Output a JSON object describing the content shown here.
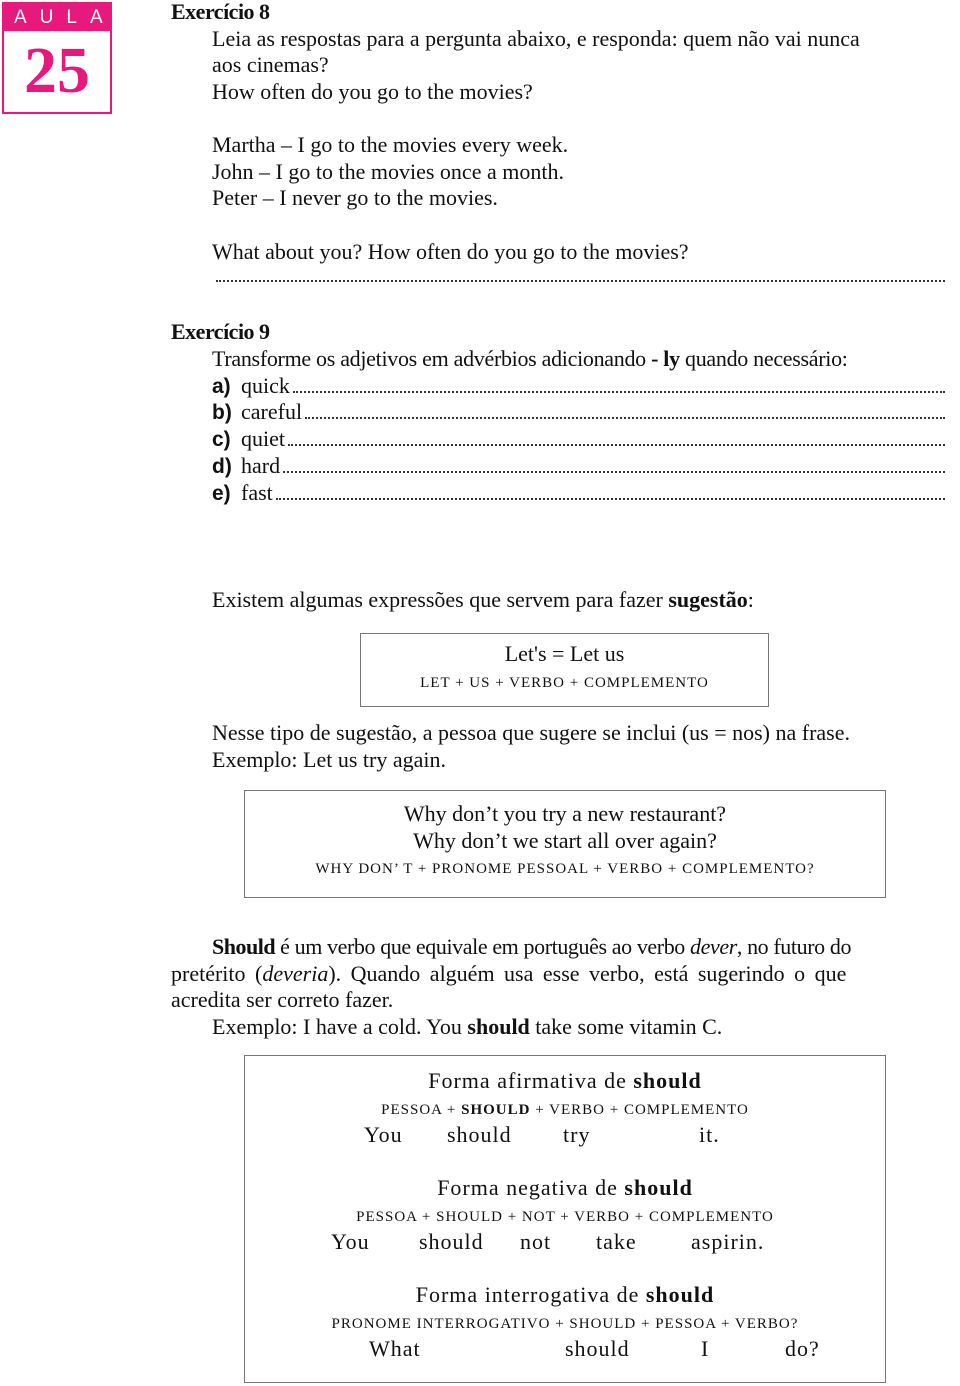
{
  "logo": {
    "label": "AULA",
    "number": "25",
    "color": "#e8197d"
  },
  "ex8": {
    "title": "Exercício 8",
    "instruction_1": "Leia as respostas para a pergunta abaixo, e responda: quem não vai nunca",
    "instruction_2": "aos cinemas?",
    "question": "How often do you go to the movies?",
    "answers": [
      "Martha – I go to the movies every week.",
      "John – I go to the movies once a month.",
      "Peter – I never go to the movies."
    ],
    "prompt": "What about you? How often do you go to the movies?"
  },
  "ex9": {
    "title": "Exercício 9",
    "instruction_pre": "Transforme os adjetivos em advérbios adicionando ",
    "instruction_bold": "- ly",
    "instruction_post": " quando necessário:",
    "items": [
      {
        "label": "a)",
        "word": "quick"
      },
      {
        "label": "b)",
        "word": "careful"
      },
      {
        "label": "c)",
        "word": "quiet"
      },
      {
        "label": "d)",
        "word": "hard"
      },
      {
        "label": "e)",
        "word": "fast"
      }
    ]
  },
  "suggestion": {
    "intro_pre": "Existem algumas expressões que servem para fazer ",
    "intro_bold": "sugestão",
    "intro_post": ":",
    "box1": {
      "line1": "Let's = Let us",
      "formula": "LET + US + VERBO + COMPLEMENTO"
    },
    "note1": "Nesse tipo de sugestão, a pessoa que sugere se inclui (us = nos) na frase.",
    "note2": "Exemplo: Let us try again.",
    "box2": {
      "line1": "Why don’t you try a new restaurant?",
      "line2": "Why don’t we start all over again?",
      "formula": "WHY DON’ T + PRONOME PESSOAL + VERBO + COMPLEMENTO?"
    }
  },
  "should": {
    "p_bold": "Should",
    "p1a": " é um verbo que equivale em português ao verbo ",
    "p1_italic": "dever",
    "p1b": ", no futuro do",
    "p2a": "pretérito (",
    "p2_italic": "deveria",
    "p2b": "). Quando alguém usa esse verbo, está sugerindo o que",
    "p3": "acredita ser correto fazer.",
    "ex_pre": "Exemplo:  I have a cold. You ",
    "ex_bold": "should",
    "ex_post": " take some vitamin C.",
    "affirm": {
      "title_pre": "Forma afirmativa de ",
      "title_bold": "should",
      "f1": "PESSOA + ",
      "f_bold": "SHOULD",
      "f2": " + VERBO + COMPLEMENTO",
      "words": [
        "You",
        "should",
        "try",
        "it."
      ]
    },
    "neg": {
      "title_pre": "Forma negativa de ",
      "title_bold": "should",
      "formula": "PESSOA + SHOULD + NOT + VERBO + COMPLEMENTO",
      "words": [
        "You",
        "should",
        "not",
        "take",
        "aspirin."
      ]
    },
    "inter": {
      "title_pre": "Forma interrogativa de ",
      "title_bold": "should",
      "formula": "PRONOME INTERROGATIVO + SHOULD + PESSOA + VERBO?",
      "words": [
        "What",
        "should",
        "I",
        "do?"
      ]
    }
  }
}
